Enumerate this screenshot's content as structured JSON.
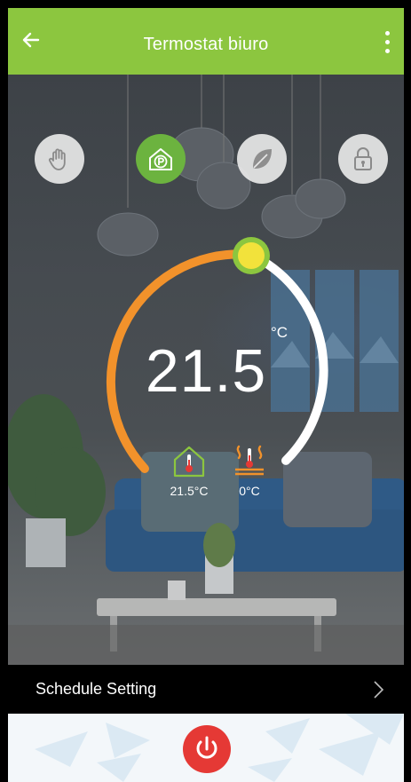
{
  "header": {
    "title": "Termostat biuro",
    "back_icon": "back-arrow-icon",
    "menu_icon": "more-vertical-icon",
    "color": "#8cc63f"
  },
  "modes": [
    {
      "id": "manual",
      "icon": "hand-icon",
      "active": false
    },
    {
      "id": "program",
      "icon": "house-program-icon",
      "active": true
    },
    {
      "id": "eco",
      "icon": "leaf-icon",
      "active": false
    },
    {
      "id": "lock",
      "icon": "lock-icon",
      "active": false
    }
  ],
  "thermostat": {
    "setpoint": "21.5",
    "unit": "°C",
    "arc_color": "#f2922b",
    "track_color": "#ffffff",
    "knob_color": "#f2e23b",
    "knob_ring_color": "#8cc63f"
  },
  "sensors": {
    "room": {
      "icon": "room-thermometer-icon",
      "value": "21.5°C"
    },
    "floor": {
      "icon": "floor-heating-thermometer-icon",
      "value": "0°C"
    }
  },
  "schedule": {
    "label": "Schedule Setting",
    "chevron_icon": "chevron-right-icon"
  },
  "power": {
    "icon": "power-icon",
    "color": "#e53935"
  }
}
